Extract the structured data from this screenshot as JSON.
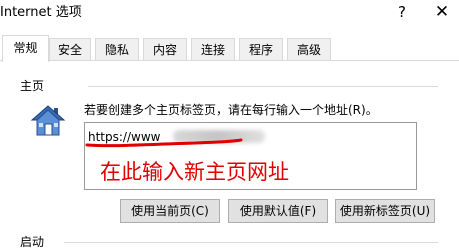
{
  "window": {
    "title": "Internet 选项",
    "help_glyph": "?",
    "close_glyph": "✕"
  },
  "tabs": [
    {
      "label": "常规",
      "active": true
    },
    {
      "label": "安全",
      "active": false
    },
    {
      "label": "隐私",
      "active": false
    },
    {
      "label": "内容",
      "active": false
    },
    {
      "label": "连接",
      "active": false
    },
    {
      "label": "程序",
      "active": false
    },
    {
      "label": "高级",
      "active": false
    }
  ],
  "home_section": {
    "header": "主页",
    "icon": "house-icon",
    "instruction": "若要创建多个主页标签页，请在每行输入一个地址(R)。",
    "url_value": "https://www",
    "annotation": "在此输入新主页网址",
    "annotation_color": "#e00000"
  },
  "buttons": {
    "use_current": "使用当前页(C)",
    "use_default": "使用默认值(F)",
    "use_new_tab": "使用新标签页(U)"
  },
  "startup_section": {
    "header": "启动"
  },
  "colors": {
    "border": "#d9d9d9",
    "button_bg": "#e1e1e1",
    "button_border": "#adadad",
    "house_roof": "#3a6bb5",
    "house_body": "#5b8fd6"
  }
}
